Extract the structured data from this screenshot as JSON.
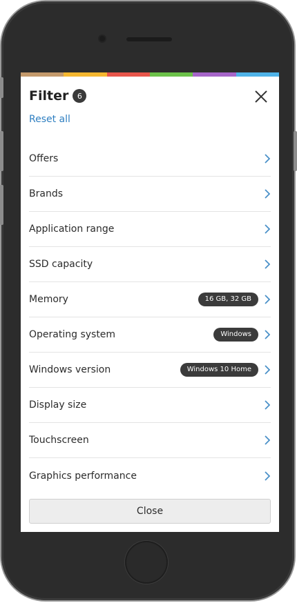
{
  "header": {
    "title": "Filter",
    "count": "6",
    "reset_label": "Reset all"
  },
  "color_strip": [
    "#c49a6c",
    "#f5b730",
    "#e8564b",
    "#6cc24a",
    "#a665c9",
    "#4fb3e8"
  ],
  "filters": [
    {
      "label": "Offers",
      "tag": ""
    },
    {
      "label": "Brands",
      "tag": ""
    },
    {
      "label": "Application range",
      "tag": ""
    },
    {
      "label": "SSD capacity",
      "tag": ""
    },
    {
      "label": "Memory",
      "tag": "16 GB, 32 GB"
    },
    {
      "label": "Operating system",
      "tag": "Windows"
    },
    {
      "label": "Windows version",
      "tag": "Windows 10 Home"
    },
    {
      "label": "Display size",
      "tag": ""
    },
    {
      "label": "Touchscreen",
      "tag": ""
    },
    {
      "label": "Graphics performance",
      "tag": ""
    }
  ],
  "footer": {
    "close_label": "Close"
  },
  "colors": {
    "link": "#2f7fc1",
    "chevron": "#4a90c8",
    "badge": "#3b3b3b"
  },
  "icons": {
    "close": "close-icon",
    "chevron": "chevron-right-icon"
  }
}
